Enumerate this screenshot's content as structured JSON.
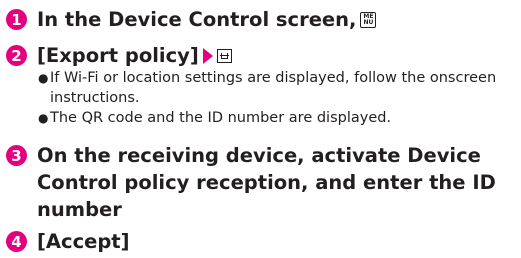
{
  "steps": [
    {
      "number": "1",
      "text": "In the Device Control screen,",
      "key_icon": "menu-key-icon",
      "key_top": "ME",
      "key_bottom": "NU"
    },
    {
      "number": "2",
      "text": "[Export policy]",
      "arrow_icon": "right-triangle-icon",
      "softkey_icon": "softkey-icon",
      "bullets": [
        "If Wi-Fi or location settings are displayed, follow the onscreen instructions.",
        "The QR code and the ID number are displayed."
      ]
    },
    {
      "number": "3",
      "text": "On the receiving device, activate Device Control policy reception, and enter the ID number"
    },
    {
      "number": "4",
      "text": "[Accept]"
    }
  ],
  "colors": {
    "accent": "#e4007f",
    "text": "#231f20"
  }
}
